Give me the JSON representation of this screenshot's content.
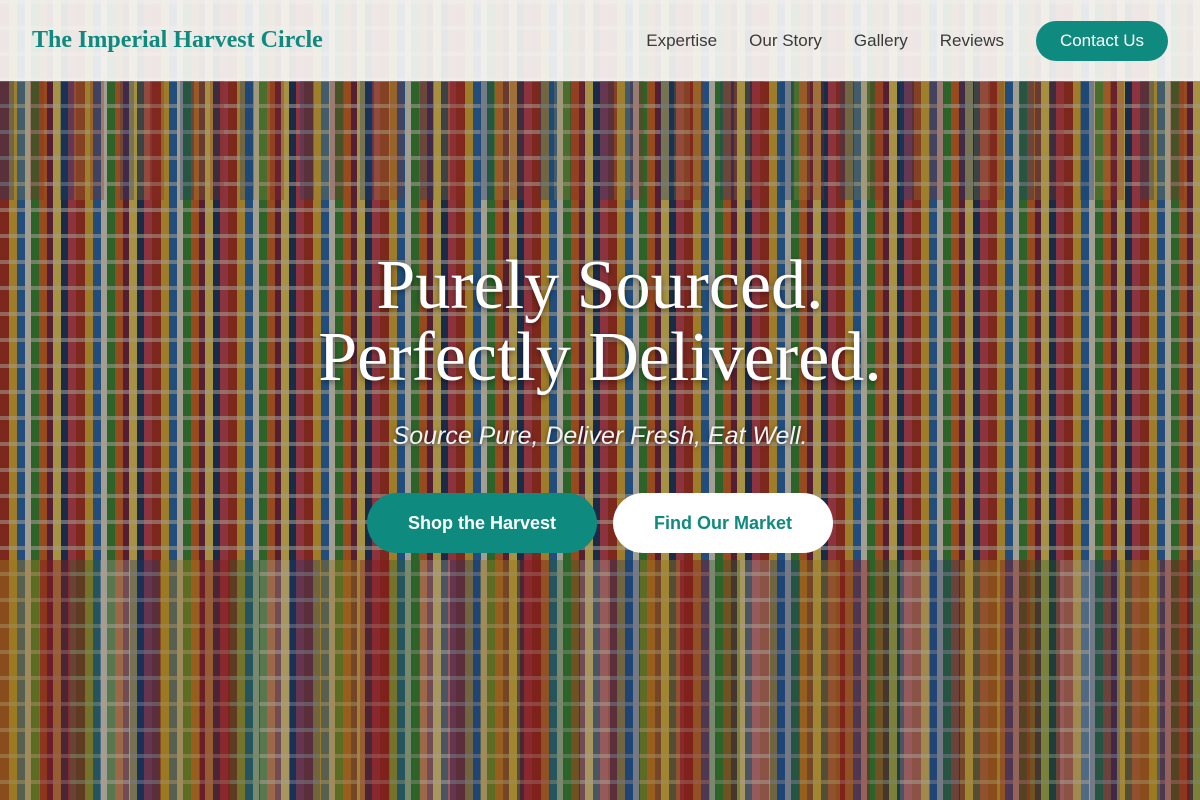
{
  "header": {
    "brand": "The Imperial Harvest Circle",
    "nav": [
      {
        "label": "Expertise"
      },
      {
        "label": "Our Story"
      },
      {
        "label": "Gallery"
      },
      {
        "label": "Reviews"
      }
    ],
    "contact_label": "Contact Us"
  },
  "hero": {
    "title_line1": "Purely Sourced.",
    "title_line2": "Perfectly Delivered.",
    "tagline": "Source Pure, Deliver Fresh, Eat Well.",
    "primary_cta": "Shop the Harvest",
    "secondary_cta": "Find Our Market"
  },
  "colors": {
    "accent": "#0f8a7e",
    "header_bg": "#f5f5f3",
    "text_light": "#ffffff"
  }
}
